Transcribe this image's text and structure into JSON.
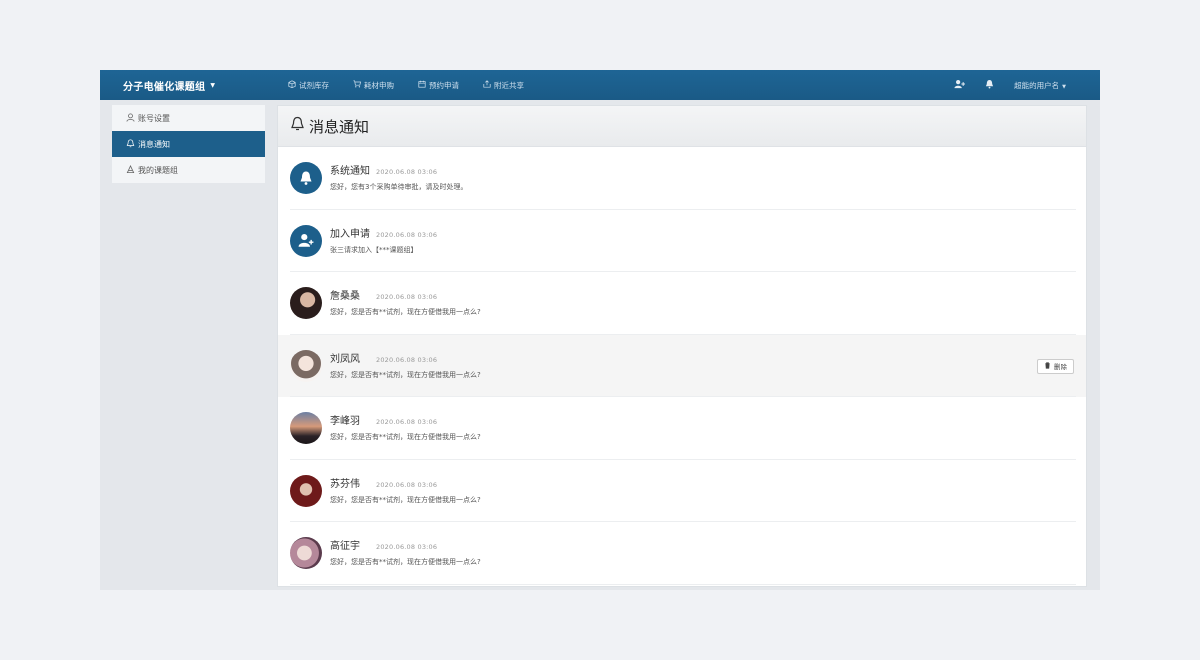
{
  "header": {
    "brand": "分子电催化课题组",
    "nav": [
      {
        "label": "试剂库存",
        "icon": "box-icon"
      },
      {
        "label": "耗材申购",
        "icon": "cart-icon"
      },
      {
        "label": "预约申请",
        "icon": "calendar-icon"
      },
      {
        "label": "附近共享",
        "icon": "share-icon"
      }
    ],
    "username": "超能的用户名"
  },
  "sidebar": {
    "items": [
      {
        "label": "账号设置",
        "icon": "user-icon",
        "active": false
      },
      {
        "label": "消息通知",
        "icon": "bell-icon",
        "active": true
      },
      {
        "label": "我的课题组",
        "icon": "group-icon",
        "active": false
      }
    ]
  },
  "main": {
    "title": "消息通知",
    "delete_label": "删除",
    "messages": [
      {
        "name": "系统通知",
        "time": "2020.06.08  03:06",
        "text": "您好，您有3个采购单待审批，请及时处理。",
        "avatar": "bell-avatar-icon"
      },
      {
        "name": "加入申请",
        "time": "2020.06.08  03:06",
        "text": "张三请求加入【***课题组】",
        "avatar": "user-add-avatar-icon"
      },
      {
        "name": "詹桑桑",
        "time": "2020.06.08  03:06",
        "text": "您好，您是否有**试剂，现在方便借我用一点么?",
        "avatar": "photo"
      },
      {
        "name": "刘凤风",
        "time": "2020.06.08  03:06",
        "text": "您好，您是否有**试剂，现在方便借我用一点么?",
        "avatar": "photo"
      },
      {
        "name": "李峰羽",
        "time": "2020.06.08  03:06",
        "text": "您好，您是否有**试剂，现在方便借我用一点么?",
        "avatar": "photo"
      },
      {
        "name": "苏芬伟",
        "time": "2020.06.08  03:06",
        "text": "您好，您是否有**试剂，现在方便借我用一点么?",
        "avatar": "photo"
      },
      {
        "name": "高征宇",
        "time": "2020.06.08  03:06",
        "text": "您好，您是否有**试剂，现在方便借我用一点么?",
        "avatar": "photo"
      }
    ]
  },
  "colors": {
    "primary": "#1d5f8b",
    "background": "#f0f2f5",
    "panel": "#ffffff"
  }
}
